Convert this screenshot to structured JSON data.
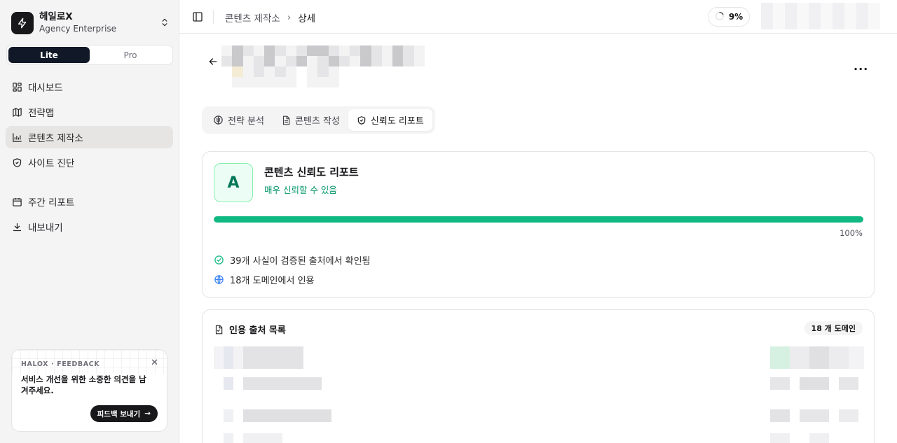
{
  "sidebar": {
    "brand_name": "헤일로X",
    "brand_plan": "Agency Enterprise",
    "plan_toggle": [
      "Lite",
      "Pro"
    ],
    "plan_selected": "Lite",
    "nav": [
      {
        "label": "대시보드",
        "icon": "dashboard-grid-icon"
      },
      {
        "label": "전략맵",
        "icon": "map-icon"
      },
      {
        "label": "콘텐츠 제작소",
        "icon": "chart-icon",
        "active": true
      },
      {
        "label": "사이트 진단",
        "icon": "shield-icon"
      }
    ],
    "nav_secondary": [
      {
        "label": "주간 리포트",
        "icon": "calendar-icon"
      },
      {
        "label": "내보내기",
        "icon": "download-icon"
      }
    ],
    "feedback": {
      "label": "HALOX · FEEDBACK",
      "text": "서비스 개선을 위한 소중한 의견을 남겨주세요.",
      "button": "피드백 보내기"
    }
  },
  "header": {
    "breadcrumb": [
      "콘텐츠 제작소",
      "상세"
    ],
    "progress": "9%"
  },
  "tabs": [
    {
      "label": "전략 분석",
      "icon": "brain-icon"
    },
    {
      "label": "콘텐츠 작성",
      "icon": "document-icon"
    },
    {
      "label": "신뢰도 리포트",
      "icon": "shield-check-icon",
      "active": true
    }
  ],
  "report": {
    "grade": "A",
    "title": "콘텐츠 신뢰도 리포트",
    "subtitle": "매우 신뢰할 수 있음",
    "score": 100,
    "score_label": "100%",
    "stat_verified": "39개 사실이 검증된 출처에서 확인됨",
    "stat_domains": "18개 도메인에서 인용",
    "accent": "#10b981"
  },
  "sources": {
    "title": "인용 출처 목록",
    "badge": "18 개 도메인"
  }
}
